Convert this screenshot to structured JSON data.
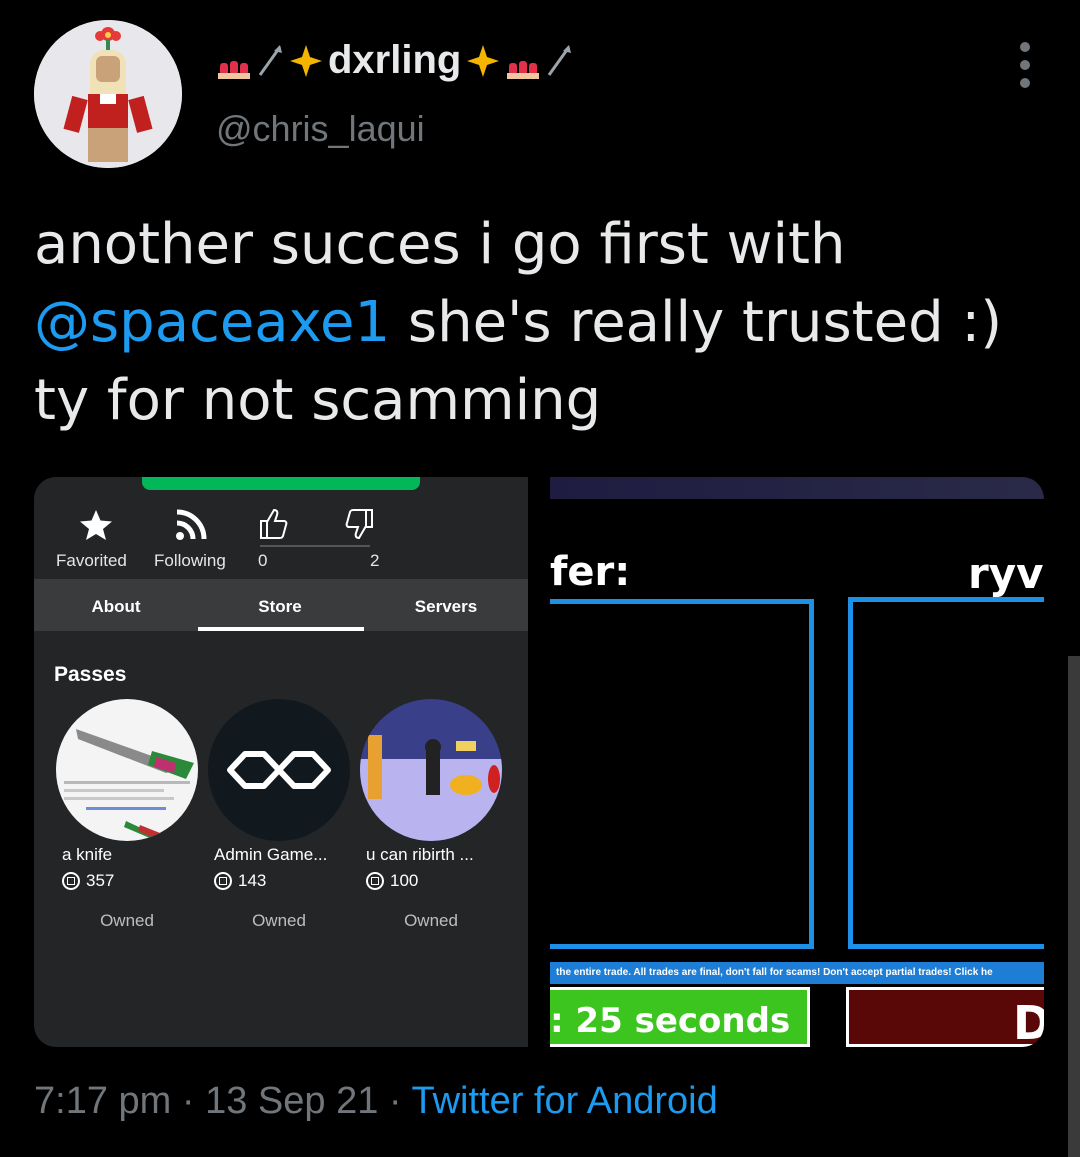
{
  "author": {
    "display_name": "dxrling",
    "handle": "@chris_laqui",
    "name_emoji": [
      "nail-polish",
      "arrow",
      "sparkles",
      "sparkles",
      "nail-polish",
      "arrow"
    ]
  },
  "tweet": {
    "text_parts": [
      "another succes i go first with ",
      "@spaceaxe1",
      " she's really trusted :) ty for not scamming"
    ]
  },
  "media_left": {
    "stats": [
      {
        "label": "Favorited",
        "icon": "star-icon"
      },
      {
        "label": "Following",
        "icon": "rss-icon"
      },
      {
        "label": "0",
        "icon": "thumbs-up-icon"
      },
      {
        "label": "2",
        "icon": "thumbs-down-icon"
      }
    ],
    "tabs": [
      "About",
      "Store",
      "Servers"
    ],
    "active_tab": "Store",
    "section_title": "Passes",
    "passes": [
      {
        "name": "a knife",
        "price": "357",
        "status": "Owned"
      },
      {
        "name": "Admin Game...",
        "price": "143",
        "status": "Owned"
      },
      {
        "name": "u can ribirth ...",
        "price": "100",
        "status": "Owned"
      }
    ]
  },
  "media_right": {
    "label_left": "fer:",
    "label_right": "ryv",
    "banner_text": "the entire trade. All trades are final, don't fall for scams! Don't accept partial trades! Click he",
    "timer_text": ": 25 seconds",
    "button_right_text": "D"
  },
  "footer": {
    "time": "7:17 pm",
    "date": "13 Sep 21",
    "source": "Twitter for Android"
  },
  "colors": {
    "mention": "#1d9bf0",
    "muted": "#71767b",
    "roblox_green": "#02b757",
    "trade_blue": "#1e90e6"
  }
}
